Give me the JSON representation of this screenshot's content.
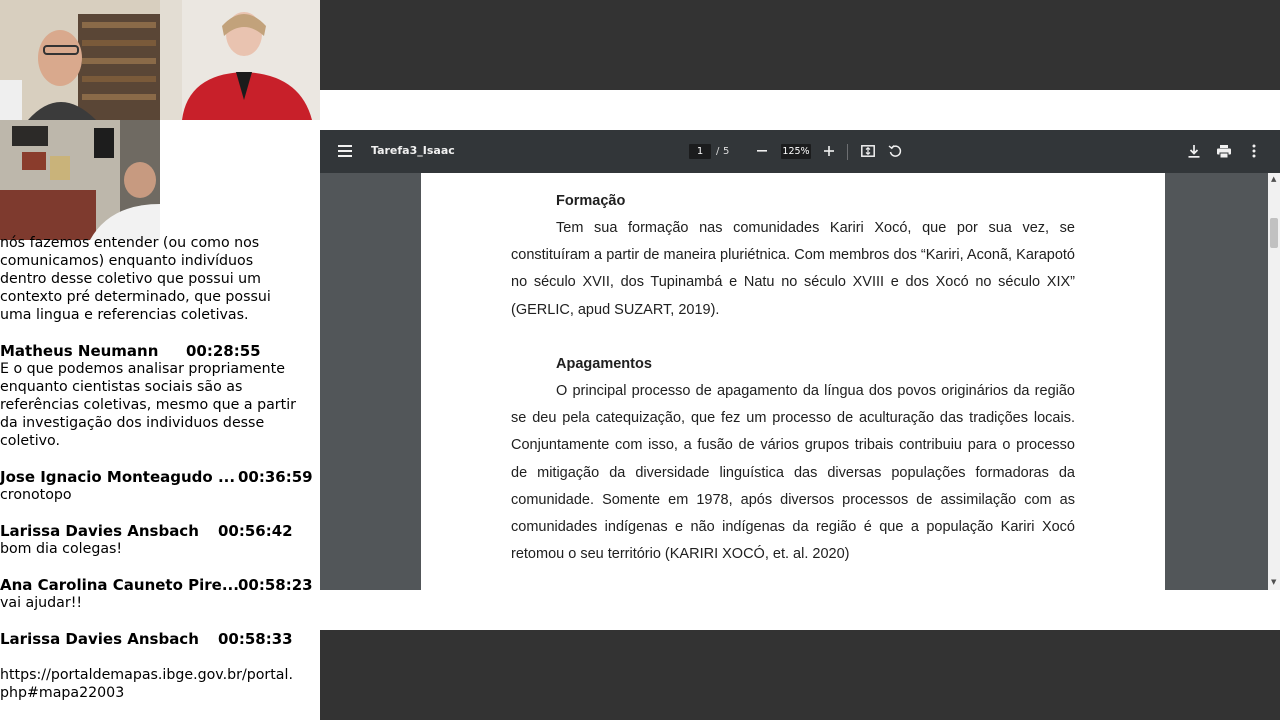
{
  "chat": {
    "continued_text": "nós fazemos entender (ou como nos\ncomunicamos) enquanto indivíduos\ndentro desse coletivo que possui um\ncontexto pré determinado, que possui\numa lingua e referencias coletivas.",
    "messages": [
      {
        "name": "Matheus Neumann",
        "time": "00:28:55",
        "text": "E o que podemos analisar propriamente\nenquanto cientistas sociais são as\nreferências coletivas, mesmo que a partir\nda investigação dos individuos desse\ncoletivo."
      },
      {
        "name": "Jose Ignacio Monteagudo ...",
        "time": "00:36:59",
        "text": "cronotopo"
      },
      {
        "name": "Larissa Davies Ansbach",
        "time": "00:56:42",
        "text": "bom dia colegas!"
      },
      {
        "name": "Ana Carolina Cauneto Pire...",
        "time": "00:58:23",
        "text": "vai ajudar!!"
      },
      {
        "name": "Larissa Davies Ansbach",
        "time": "00:58:33",
        "text": "\nhttps://portaldemapas.ibge.gov.br/portal.\nphp#mapa22003"
      }
    ]
  },
  "pdf": {
    "title": "Tarefa3_Isaac",
    "page_current": "1",
    "page_separator": "/",
    "page_total": "5",
    "zoom": "125%",
    "sections": [
      {
        "heading": "Formação",
        "body": "Tem sua formação nas comunidades Kariri Xocó, que por sua vez, se constituíram a partir de maneira pluriétnica. Com membros dos “Kariri, Aconã, Karapotó no século XVII, dos Tupinambá e Natu no século XVIII e dos Xocó no século XIX” (GERLIC, apud SUZART, 2019)."
      },
      {
        "heading": "Apagamentos",
        "body": "O principal processo de apagamento da língua dos povos originários da região se deu pela catequização, que fez um processo de aculturação das tradições locais. Conjuntamente com isso, a fusão de vários grupos tribais contribuiu para o processo de mitigação da diversidade linguística das diversas populações formadoras da comunidade. Somente em 1978, após diversos processos de assimilação com as comunidades indígenas e não indígenas da região é que a população Kariri Xocó retomou o seu território (KARIRI XOCÓ, et. al. 2020)"
      }
    ]
  },
  "icons": {
    "menu": "menu-icon",
    "zoom_out": "minus-icon",
    "zoom_in": "plus-icon",
    "fit": "fit-page-icon",
    "rotate": "rotate-icon",
    "download": "download-icon",
    "print": "print-icon",
    "more": "more-vert-icon"
  },
  "colors": {
    "toolbar": "#323639",
    "viewer_bg": "#525659",
    "outer_bg": "#333333"
  }
}
